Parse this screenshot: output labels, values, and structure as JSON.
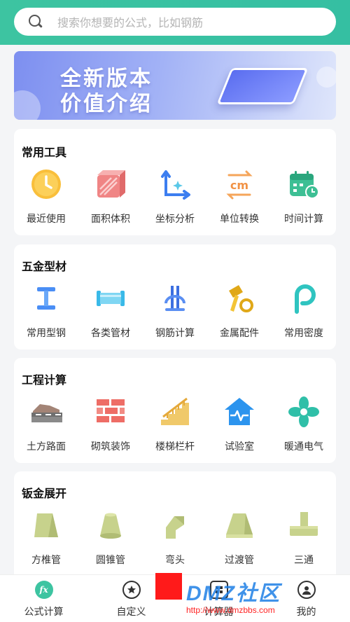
{
  "search": {
    "placeholder": "搜索你想要的公式，比如钢筋"
  },
  "banner": {
    "line1": "全新版本",
    "line2": "价值介绍"
  },
  "sections": [
    {
      "title": "常用工具",
      "items": [
        "最近使用",
        "面积体积",
        "坐标分析",
        "单位转换",
        "时间计算"
      ]
    },
    {
      "title": "五金型材",
      "items": [
        "常用型钢",
        "各类管材",
        "钢筋计算",
        "金属配件",
        "常用密度"
      ]
    },
    {
      "title": "工程计算",
      "items": [
        "土方路面",
        "砌筑装饰",
        "楼梯栏杆",
        "试验室",
        "暖通电气"
      ]
    },
    {
      "title": "钣金展开",
      "items": [
        "方椎管",
        "圆锥管",
        "弯头",
        "过渡管",
        "三通"
      ]
    }
  ],
  "tabs": [
    {
      "label": "公式计算",
      "icon": "fx-icon"
    },
    {
      "label": "自定义",
      "icon": "star-icon"
    },
    {
      "label": "计算器",
      "icon": "calculator-icon"
    },
    {
      "label": "我的",
      "icon": "user-icon"
    }
  ],
  "icon_glyphs": {
    "fx": "fx",
    "cm": "cm"
  },
  "watermark": {
    "logo": "DMZ社区",
    "url": "http://www.dmzbbs.com"
  },
  "colors": {
    "accent": "#3dc4a1",
    "yellow": "#f7b733",
    "blue": "#4a8ef5",
    "red": "#f06b6b",
    "green": "#35bfa2",
    "olive": "#c7d28c"
  }
}
